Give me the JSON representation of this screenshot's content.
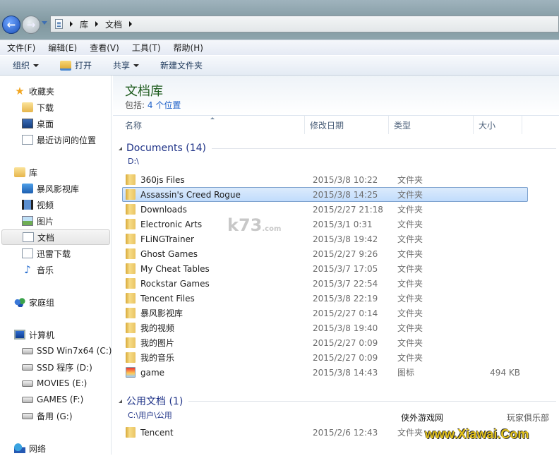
{
  "address": {
    "crumbs": [
      "库",
      "文档"
    ]
  },
  "menu": [
    "文件(F)",
    "编辑(E)",
    "查看(V)",
    "工具(T)",
    "帮助(H)"
  ],
  "toolbar": {
    "organize": "组织",
    "open": "打开",
    "share": "共享",
    "new_folder": "新建文件夹"
  },
  "sidebar": {
    "favorites": {
      "label": "收藏夹",
      "items": [
        "下载",
        "桌面",
        "最近访问的位置"
      ]
    },
    "libraries": {
      "label": "库",
      "items": [
        "暴风影视库",
        "视频",
        "图片",
        "文档",
        "迅雷下载",
        "音乐"
      ],
      "selected": "文档"
    },
    "homegroup": {
      "label": "家庭组"
    },
    "computer": {
      "label": "计算机",
      "items": [
        "SSD Win7x64 (C:)",
        "SSD 程序 (D:)",
        "MOVIES (E:)",
        "GAMES (F:)",
        "备用 (G:)"
      ]
    },
    "network": {
      "label": "网络"
    }
  },
  "library": {
    "title": "文档库",
    "includes_label": "包括:",
    "includes_link": "4 个位置"
  },
  "columns": [
    "名称",
    "修改日期",
    "类型",
    "大小"
  ],
  "groups": [
    {
      "title": "Documents (14)",
      "path": "D:\\",
      "items": [
        {
          "name": "360js Files",
          "date": "2015/3/8 10:22",
          "type": "文件夹",
          "size": ""
        },
        {
          "name": "Assassin's Creed Rogue",
          "date": "2015/3/8 14:25",
          "type": "文件夹",
          "size": "",
          "selected": true
        },
        {
          "name": "Downloads",
          "date": "2015/2/27 21:18",
          "type": "文件夹",
          "size": ""
        },
        {
          "name": "Electronic Arts",
          "date": "2015/3/1 0:31",
          "type": "文件夹",
          "size": ""
        },
        {
          "name": "FLiNGTrainer",
          "date": "2015/3/8 19:42",
          "type": "文件夹",
          "size": ""
        },
        {
          "name": "Ghost Games",
          "date": "2015/2/27 9:26",
          "type": "文件夹",
          "size": ""
        },
        {
          "name": "My Cheat Tables",
          "date": "2015/3/7 17:05",
          "type": "文件夹",
          "size": ""
        },
        {
          "name": "Rockstar Games",
          "date": "2015/3/7 22:54",
          "type": "文件夹",
          "size": ""
        },
        {
          "name": "Tencent Files",
          "date": "2015/3/8 22:19",
          "type": "文件夹",
          "size": ""
        },
        {
          "name": "暴风影视库",
          "date": "2015/2/27 0:14",
          "type": "文件夹",
          "size": ""
        },
        {
          "name": "我的视频",
          "date": "2015/3/8 19:40",
          "type": "文件夹",
          "size": ""
        },
        {
          "name": "我的图片",
          "date": "2015/2/27 0:09",
          "type": "文件夹",
          "size": ""
        },
        {
          "name": "我的音乐",
          "date": "2015/2/27 0:09",
          "type": "文件夹",
          "size": ""
        },
        {
          "name": "game",
          "date": "2015/3/8 14:43",
          "type": "图标",
          "size": "494 KB",
          "icon": "3dm-icon"
        }
      ]
    },
    {
      "title": "公用文档 (1)",
      "path": "C:\\用户\\公用",
      "items": [
        {
          "name": "Tencent",
          "date": "2015/2/6 12:43",
          "type": "文件夹",
          "size": ""
        }
      ]
    }
  ],
  "watermarks": {
    "k73": "k73.com 电玩之家",
    "xiawai_left": "侠外游戏网",
    "xiawai_url": "www.Xiawai.Com",
    "xiawai_right": "玩家俱乐部"
  }
}
